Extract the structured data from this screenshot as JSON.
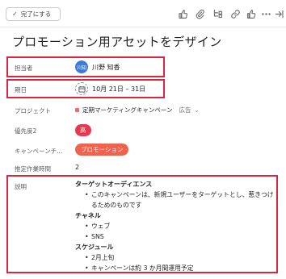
{
  "toolbar": {
    "complete_label": "完了にする",
    "icons": [
      "thumbs-up-icon",
      "attachment-icon",
      "subtask-icon",
      "link-icon",
      "like-icon",
      "more-icon",
      "close-panel-icon"
    ]
  },
  "task": {
    "title": "プロモーション用アセットをデザイン"
  },
  "fields": {
    "assignee": {
      "label": "担当者",
      "avatar_initials": "川知",
      "name": "川野 知香"
    },
    "due": {
      "label": "期日",
      "value": "10月 21日 – 31日"
    },
    "project": {
      "label": "プロジェクト",
      "name": "定期マーケティングキャンペーン",
      "section": "広告",
      "color": "#f06a6a"
    },
    "priority": {
      "label": "優先度2",
      "value": "高",
      "color": "#e8384f"
    },
    "campaign": {
      "label": "キャンペーンチ...",
      "value": "プロモーション",
      "color": "#f0624d"
    },
    "estimate": {
      "label": "推定作業時間",
      "value": "2"
    }
  },
  "description": {
    "label": "説明",
    "sections": [
      {
        "heading": "ターゲットオーディエンス",
        "items": [
          "このキャンペーンは、新規ユーザーをターゲットとし、惹きつけるためのものです"
        ]
      },
      {
        "heading": "チャネル",
        "items": [
          "ウェブ",
          "SNS"
        ]
      },
      {
        "heading": "スケジュール",
        "items": [
          "2月上旬",
          "キャンペーンは約 3 か月間運用予定"
        ]
      }
    ]
  },
  "highlight_color": "#d7263d"
}
